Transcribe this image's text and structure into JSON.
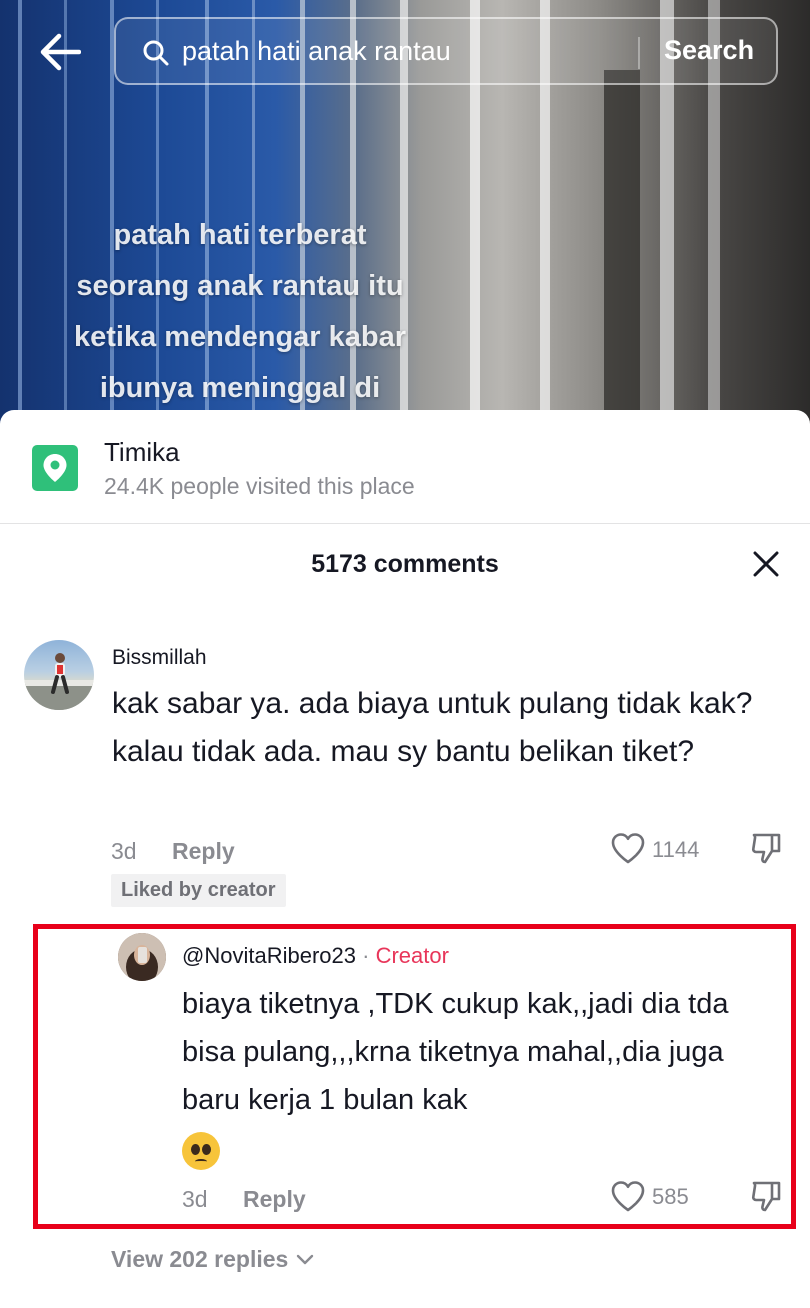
{
  "search": {
    "query": "patah hati anak rantau",
    "button_label": "Search"
  },
  "video": {
    "caption_lines": [
      "patah hati terberat",
      "seorang anak rantau itu",
      "ketika mendengar kabar",
      "ibunya meninggal di"
    ]
  },
  "location": {
    "name": "Timika",
    "subtitle": "24.4K people visited this place",
    "icon_color": "#2fc07a"
  },
  "comments": {
    "count_label": "5173 comments",
    "items": [
      {
        "username": "Bissmillah",
        "text": "kak sabar ya. ada biaya untuk pulang tidak kak? kalau tidak ada. mau sy bantu belikan tiket?",
        "time": "3d",
        "reply_label": "Reply",
        "likes": "1144",
        "badge": "Liked by creator"
      }
    ],
    "reply": {
      "username": "@NovitaRibero23",
      "separator": "·",
      "role": "Creator",
      "text": "biaya tiketnya ,TDK cukup kak,,jadi dia tda bisa pulang,,,krna tiketnya mahal,,dia juga baru kerja 1 bulan kak",
      "emoji": "pleading-face",
      "time": "3d",
      "reply_label": "Reply",
      "likes": "585",
      "highlight_color": "#e8001a"
    },
    "view_replies_label": "View 202 replies"
  }
}
